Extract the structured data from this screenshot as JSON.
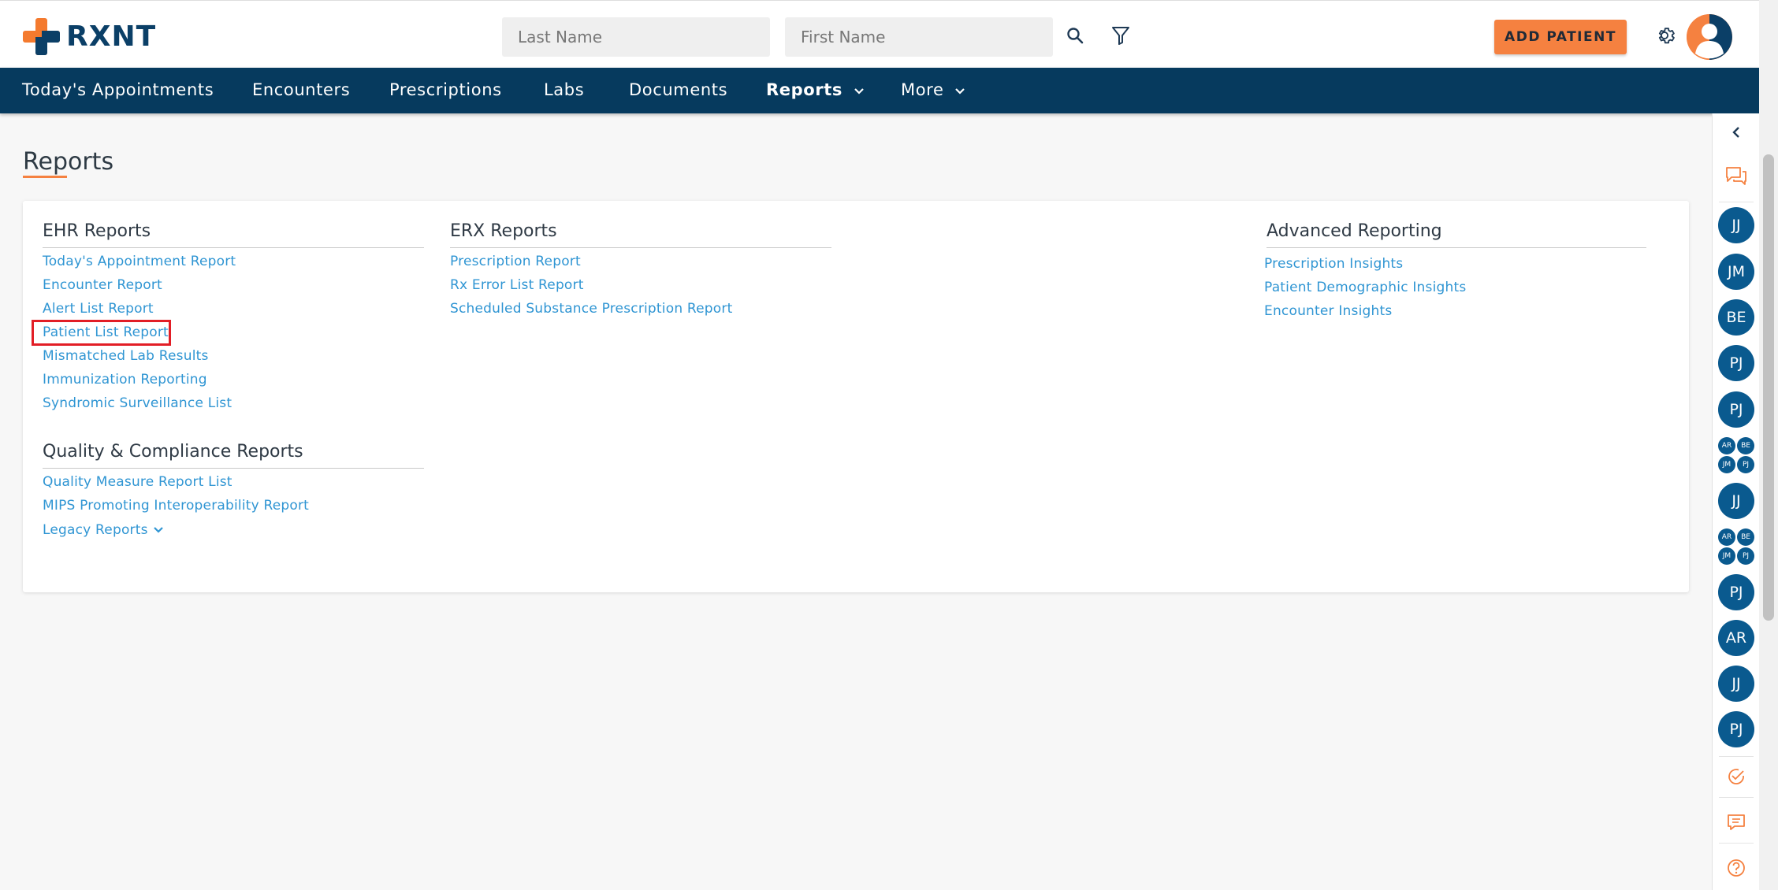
{
  "header": {
    "logo_text": "RXNT",
    "last_name_placeholder": "Last Name",
    "first_name_placeholder": "First Name",
    "add_patient_label": "ADD PATIENT"
  },
  "nav": {
    "items": [
      {
        "label": "Today's Appointments"
      },
      {
        "label": "Encounters"
      },
      {
        "label": "Prescriptions"
      },
      {
        "label": "Labs"
      },
      {
        "label": "Documents"
      },
      {
        "label": "Reports"
      },
      {
        "label": "More"
      }
    ]
  },
  "page": {
    "title": "Reports"
  },
  "ehr": {
    "title": "EHR Reports",
    "links": [
      "Today's Appointment Report",
      "Encounter Report",
      "Alert List Report",
      "Patient List Report",
      "Mismatched Lab Results",
      "Immunization Reporting",
      "Syndromic Surveillance List"
    ]
  },
  "quality": {
    "title": "Quality & Compliance Reports",
    "links": [
      "Quality Measure Report List",
      "MIPS Promoting Interoperability Report",
      "Legacy Reports"
    ]
  },
  "erx": {
    "title": "ERX Reports",
    "links": [
      "Prescription Report",
      "Rx Error List Report",
      "Scheduled Substance Prescription Report"
    ]
  },
  "advanced": {
    "title": "Advanced Reporting",
    "links": [
      "Prescription Insights",
      "Patient Demographic Insights",
      "Encounter Insights"
    ]
  },
  "sidebar": {
    "avatars": [
      {
        "initials": "JJ"
      },
      {
        "initials": "JM"
      },
      {
        "initials": "BE"
      },
      {
        "initials": "PJ"
      },
      {
        "initials": "PJ"
      },
      {
        "group": [
          "AR",
          "BE",
          "JM",
          "PJ"
        ]
      },
      {
        "initials": "JJ"
      },
      {
        "group": [
          "AR",
          "BE",
          "JM",
          "PJ"
        ]
      },
      {
        "initials": "PJ"
      },
      {
        "initials": "AR"
      },
      {
        "initials": "JJ"
      },
      {
        "initials": "PJ"
      }
    ]
  },
  "colors": {
    "brand_orange": "#f58140",
    "brand_navy": "#063a5e",
    "link_blue": "#2f95d3",
    "avatar_blue": "#0a5a8f",
    "highlight_red": "#e21e26"
  }
}
